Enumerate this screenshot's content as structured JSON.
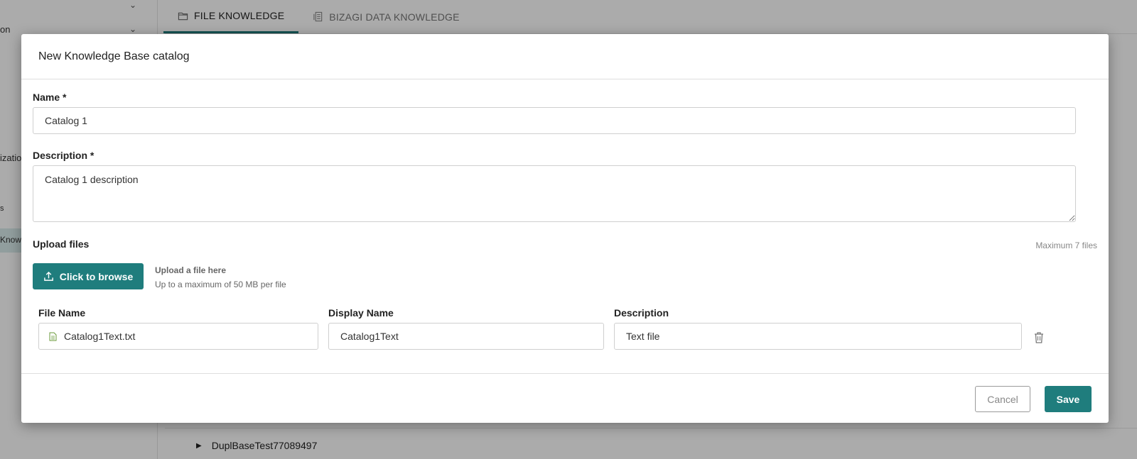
{
  "background": {
    "sidebar_items": [
      {
        "label": "",
        "top": 0
      },
      {
        "label": "on"
      },
      {
        "label": "izatio"
      },
      {
        "label": "s"
      },
      {
        "label": "Know"
      }
    ],
    "tabs": [
      {
        "label": "FILE KNOWLEDGE",
        "icon": "folder-icon",
        "active": true
      },
      {
        "label": "BIZAGI DATA KNOWLEDGE",
        "icon": "database-doc-icon",
        "active": false
      }
    ],
    "tree_rows": [
      "DuplBaseTest77089497"
    ]
  },
  "modal": {
    "title": "New Knowledge Base catalog",
    "name_label": "Name *",
    "name_value": "Catalog 1",
    "description_label": "Description *",
    "description_value": "Catalog 1 description",
    "upload_label": "Upload files",
    "max_files": "Maximum 7 files",
    "browse_label": "Click to browse",
    "upload_hint_title": "Upload a file here",
    "upload_hint_sub": "Up to a maximum of 50 MB per file",
    "columns": {
      "file_name": "File Name",
      "display_name": "Display Name",
      "description": "Description"
    },
    "files": [
      {
        "file_name": "Catalog1Text.txt",
        "display_name": "Catalog1Text",
        "description": "Text file"
      }
    ],
    "cancel_label": "Cancel",
    "save_label": "Save"
  },
  "colors": {
    "accent": "#1f7d7d",
    "overlay": "#000000"
  }
}
